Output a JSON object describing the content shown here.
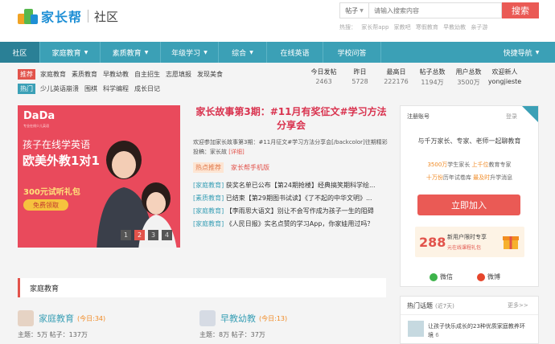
{
  "header": {
    "logo_name": "家长帮",
    "logo_sub": "社区"
  },
  "search": {
    "category": "帖子",
    "placeholder": "请输入搜索内容",
    "button": "搜索",
    "hot_label": "热搜：",
    "hot_terms": [
      "家长帮app",
      "家教吧",
      "寒假教育",
      "早教幼教",
      "亲子游"
    ]
  },
  "nav": {
    "items": [
      "社区",
      "家庭教育",
      "素质教育",
      "年级学习",
      "综合",
      "在线英语",
      "学校问答"
    ],
    "right": "快捷导航"
  },
  "tags": {
    "rec_label": "推荐",
    "rec_items": [
      "家庭教育",
      "素质教育",
      "早教幼教",
      "自主招生",
      "志愿填报",
      "发现美食"
    ],
    "hot_label": "热门",
    "hot_items": [
      "少儿英语崩溃",
      "围棋",
      "科学编程",
      "成长日记"
    ]
  },
  "stats": [
    {
      "k": "今日发帖",
      "v": "2463"
    },
    {
      "k": "昨日",
      "v": "5728"
    },
    {
      "k": "最高日",
      "v": "222176"
    },
    {
      "k": "帖子总数",
      "v": "1194万"
    },
    {
      "k": "用户总数",
      "v": "3500万"
    },
    {
      "k": "欢迎新人",
      "v": "yongjieste"
    }
  ],
  "banner": {
    "brand": "DaDa",
    "slogan": "专业在线少儿英语",
    "line1": "孩子在线学英语",
    "line2": "欧美外教1对1",
    "offer": "300元试听礼包",
    "btn": "免费领取",
    "pages": [
      "1",
      "2",
      "3",
      "4"
    ]
  },
  "story": {
    "title": "家长故事第3期：#11月有奖征文#学习方法分享会",
    "desc": "欢迎参加家长故事第3期：#11月征文#学习方法分享会[/backcolor]往期精彩投稿：家长故",
    "more": "[详细]",
    "tag_a": "热点推荐",
    "tag_b": "家长帮手机版",
    "news": [
      {
        "cat": "[家庭教育]",
        "text": "获奖名单已公布【第24期抢楼】经典搞笑期科学绘..."
      },
      {
        "cat": "[素质教育]",
        "text": "已结束【第29期图书试读】《了不起的中华文明》..."
      },
      {
        "cat": "[家庭教育]",
        "text": "【李雨思大语文】别让不会写作成为孩子一生的阻碍"
      },
      {
        "cat": "[家庭教育]",
        "text": "《人民日报》实名点赞的学习App，你家娃用过吗？"
      }
    ]
  },
  "side": {
    "reg": "注册账号",
    "login": "登录",
    "s1": "与千万家长、专家、老师一起聊教育",
    "s2a": "3500万",
    "s2b": "学生家长",
    "s2c": "上千位",
    "s2d": "教育专家",
    "s3a": "十万份",
    "s3b": "历年试卷库",
    "s3c": "最及时",
    "s3d": "升学消息",
    "join": "立即加入",
    "gift_num": "288",
    "gift_t1": "新用户限时专享",
    "gift_t2": "元在线课程礼包",
    "wechat": "微信",
    "weibo": "微博"
  },
  "hot": {
    "title": "热门话题",
    "period": "(近7天)",
    "more": "更多>>",
    "item": "让孩子快乐成长的23种优质家庭教养环境",
    "count": "6"
  },
  "section": {
    "title": "家庭教育"
  },
  "cats": [
    {
      "name": "家庭教育",
      "today": "(今日:34)",
      "stat": "主题：5万  帖子：137万"
    },
    {
      "name": "早教幼教",
      "today": "(今日:13)",
      "stat": "主题：8万  帖子：37万"
    }
  ],
  "colors": {
    "accent": "#3ba0b6",
    "brand_red": "#e2534b",
    "title_red": "#d9334f"
  }
}
